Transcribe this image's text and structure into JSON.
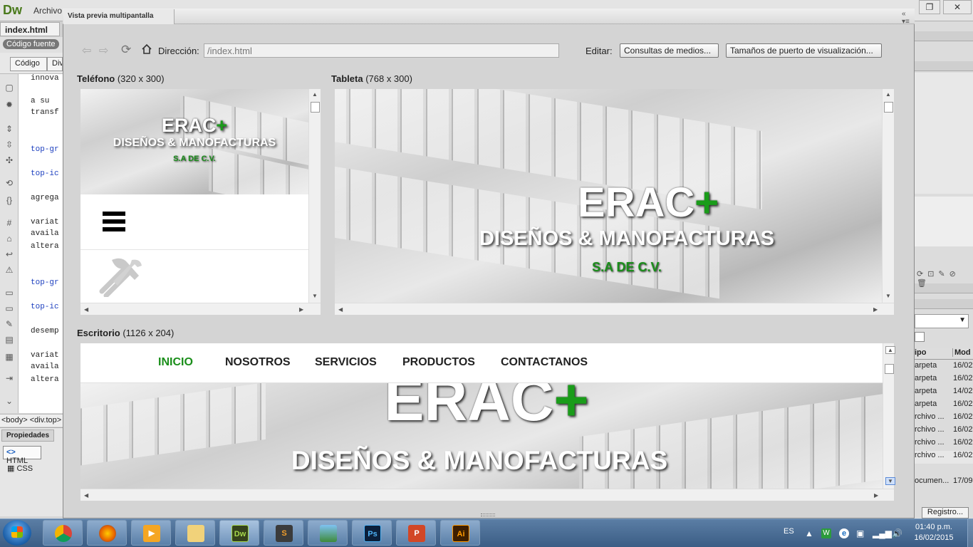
{
  "app": {
    "logo": "Dw",
    "menu_first": "Archivo"
  },
  "document_tab": {
    "name": "index.html",
    "close": "×"
  },
  "source_pill": "Código fuente",
  "view_buttons": {
    "code": "Código",
    "split": "Div"
  },
  "code_lines": [
    {
      "text": "innova",
      "blue": false
    },
    {
      "text": " a su",
      "blue": false
    },
    {
      "text": "transf",
      "blue": false
    },
    {
      "text": "top-gr",
      "blue": true
    },
    {
      "text": "top-ic",
      "blue": true
    },
    {
      "text": "agrega",
      "blue": false
    },
    {
      "text": "variat",
      "blue": false
    },
    {
      "text": "availa",
      "blue": false
    },
    {
      "text": "altera",
      "blue": false
    },
    {
      "text": "top-gr",
      "blue": true
    },
    {
      "text": "top-ic",
      "blue": true
    },
    {
      "text": "desemp",
      "blue": false
    },
    {
      "text": "variat",
      "blue": false
    },
    {
      "text": "availa",
      "blue": false
    },
    {
      "text": "altera",
      "blue": false
    }
  ],
  "tag_selector": "<body> <div.top>",
  "properties": {
    "tab": "Propiedades",
    "html": "HTML",
    "css": "CSS"
  },
  "dialog": {
    "title": "Vista previa multipantalla",
    "address_label": "Dirección:",
    "address_value": "/index.html",
    "edit_label": "Editar:",
    "media_button": "Consultas de medios...",
    "viewport_button": "Tamaños de puerto de visualización..."
  },
  "panels": {
    "phone": {
      "name": "Teléfono",
      "size": "(320 x 300)"
    },
    "tablet": {
      "name": "Tableta",
      "size": "(768 x 300)"
    },
    "desktop": {
      "name": "Escritorio",
      "size": "(1126 x 204)"
    }
  },
  "site": {
    "brand": "ERAC",
    "plus": "+",
    "subtitle": "DISEÑOS & MANOFACTURAS",
    "tagline": "S.A DE C.V.",
    "nav": [
      "INICIO",
      "NOSOTROS",
      "SERVICIOS",
      "PRODUCTOS",
      "CONTACTANOS"
    ],
    "active_color": "#1a8e1a"
  },
  "files": {
    "headers": [
      "ipo",
      "Mod"
    ],
    "rows": [
      [
        "arpeta",
        "16/02"
      ],
      [
        "arpeta",
        "16/02"
      ],
      [
        "arpeta",
        "14/02"
      ],
      [
        "arpeta",
        "16/02"
      ],
      [
        "rchivo ...",
        "16/02"
      ],
      [
        "rchivo ...",
        "16/02"
      ],
      [
        "rchivo ...",
        "16/02"
      ],
      [
        "rchivo ...",
        "16/02"
      ],
      [
        "ocumen...",
        "17/09"
      ]
    ],
    "register_button": "Registro..."
  },
  "taskbar": {
    "language": "ES",
    "time": "01:40 p.m.",
    "date": "16/02/2015",
    "apps": [
      "chrome",
      "firefox",
      "media-player",
      "explorer",
      "dreamweaver",
      "sublime",
      "photos",
      "photoshop",
      "powerpoint",
      "illustrator"
    ]
  }
}
